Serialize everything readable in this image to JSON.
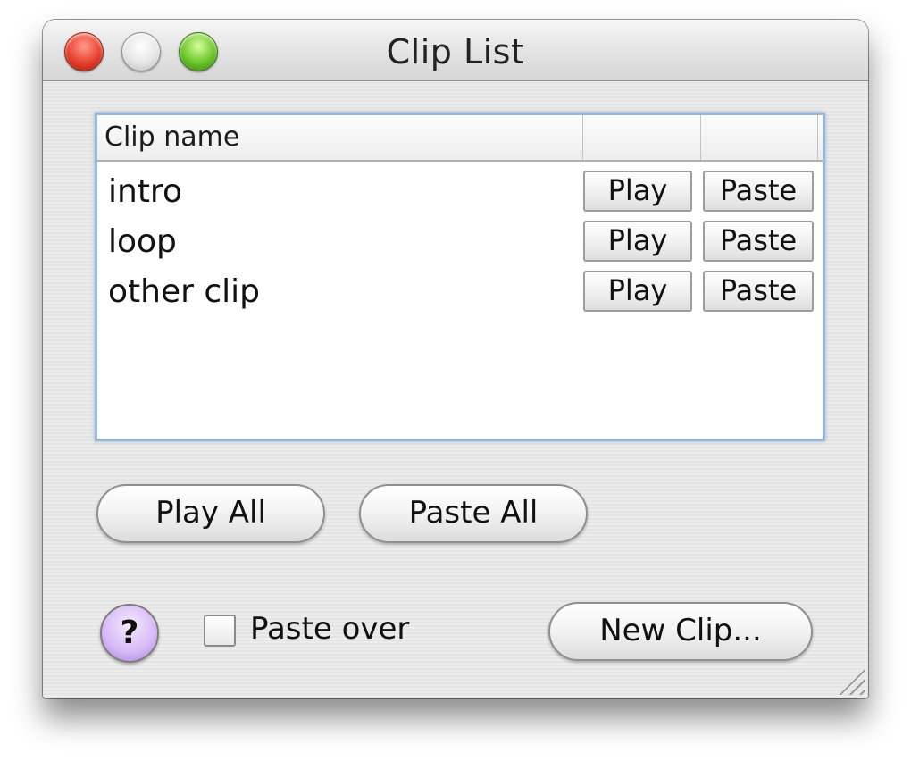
{
  "window": {
    "title": "Clip List"
  },
  "table": {
    "columns": [
      "Clip name",
      "",
      ""
    ],
    "rows": [
      {
        "name": "intro",
        "play_label": "Play",
        "paste_label": "Paste"
      },
      {
        "name": "loop",
        "play_label": "Play",
        "paste_label": "Paste"
      },
      {
        "name": "other clip",
        "play_label": "Play",
        "paste_label": "Paste"
      }
    ]
  },
  "actions": {
    "play_all_label": "Play All",
    "paste_all_label": "Paste All",
    "new_clip_label": "New Clip..."
  },
  "footer": {
    "help_label": "?",
    "paste_over_label": "Paste over",
    "paste_over_checked": false
  },
  "colors": {
    "focus_ring": "#9ab8d6",
    "close_button": "#e8402e",
    "zoom_button": "#6bc52a",
    "help_button": "#d5b8f6"
  }
}
